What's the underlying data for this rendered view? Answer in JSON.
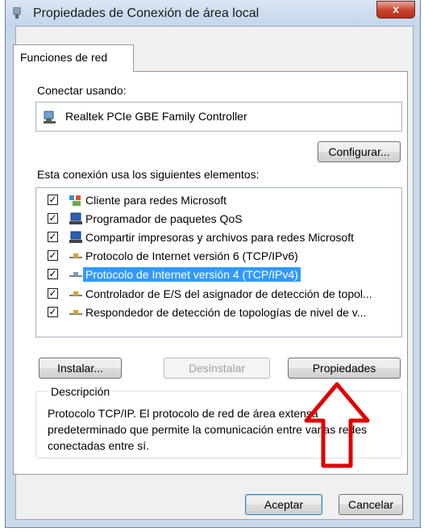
{
  "window": {
    "title": "Propiedades de Conexión de área local",
    "close_glyph": "x"
  },
  "tabs": [
    {
      "label": "Funciones de red"
    }
  ],
  "connect_using": {
    "label": "Conectar usando:",
    "adapter": "Realtek PCIe GBE Family Controller",
    "adapter_icon": "network-adapter-icon",
    "configure_button": "Configurar..."
  },
  "components": {
    "label": "Esta conexión usa los siguientes elementos:",
    "items": [
      {
        "label": "Cliente para redes Microsoft",
        "checked": true,
        "icon": "network-client-icon",
        "selected": false
      },
      {
        "label": "Programador de paquetes QoS",
        "checked": true,
        "icon": "network-service-icon",
        "selected": false
      },
      {
        "label": "Compartir impresoras y archivos para redes Microsoft",
        "checked": true,
        "icon": "network-service-icon",
        "selected": false
      },
      {
        "label": "Protocolo de Internet versión 6 (TCP/IPv6)",
        "checked": true,
        "icon": "protocol-icon",
        "selected": false
      },
      {
        "label": "Protocolo de Internet versión 4 (TCP/IPv4)",
        "checked": true,
        "icon": "protocol-icon",
        "selected": true
      },
      {
        "label": "Controlador de E/S del asignador de detección de topol...",
        "checked": true,
        "icon": "protocol-icon",
        "selected": false
      },
      {
        "label": "Respondedor de detección de topologías de nivel de v...",
        "checked": true,
        "icon": "protocol-icon",
        "selected": false
      }
    ]
  },
  "actions": {
    "install": "Instalar...",
    "uninstall": "Desinstalar",
    "properties": "Propiedades"
  },
  "description": {
    "title": "Descripción",
    "text": "Protocolo TCP/IP. El protocolo de red de área extensa predeterminado que permite la comunicación entre varias redes conectadas entre sí."
  },
  "footer": {
    "accept": "Aceptar",
    "cancel": "Cancelar"
  },
  "colors": {
    "selection": "#3399ff",
    "annotation_arrow": "#e00000",
    "close_button": "#c7402b"
  }
}
